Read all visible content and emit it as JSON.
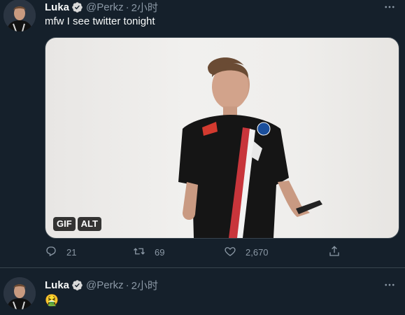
{
  "tweets": [
    {
      "author": {
        "name": "Luka",
        "handle": "@Perkz",
        "time": "2小时"
      },
      "text": "mfw I see twitter tonight",
      "media": {
        "badges": [
          "GIF",
          "ALT"
        ]
      },
      "actions": {
        "replies": "21",
        "retweets": "69",
        "likes": "2,670"
      }
    },
    {
      "author": {
        "name": "Luka",
        "handle": "@Perkz",
        "time": "2小时"
      },
      "text": "🤮"
    }
  ],
  "colors": {
    "background": "#15202b",
    "secondary_text": "#8b98a5",
    "verified": "#d9d9d9"
  },
  "icons": [
    "verified-icon",
    "more-icon",
    "reply-icon",
    "retweet-icon",
    "like-icon",
    "share-icon"
  ]
}
